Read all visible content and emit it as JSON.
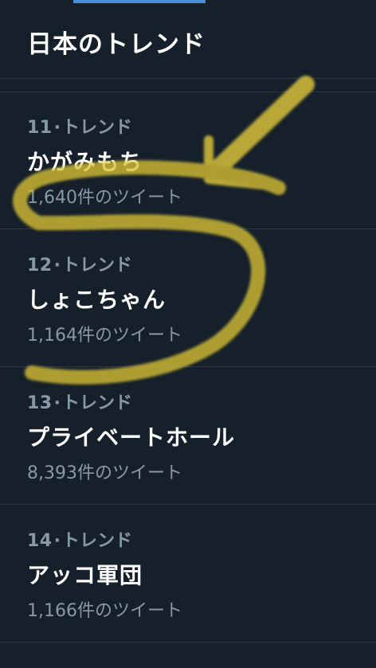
{
  "header": {
    "title": "日本のトレンド"
  },
  "trends": [
    {
      "rank": "11",
      "separator": "·",
      "label": "トレンド",
      "name": "かがみもち",
      "count": "1,640件のツイート"
    },
    {
      "rank": "12",
      "separator": "·",
      "label": "トレンド",
      "name": "しょこちゃん",
      "count": "1,164件のツイート"
    },
    {
      "rank": "13",
      "separator": "·",
      "label": "トレンド",
      "name": "プライベートホール",
      "count": "8,393件のツイート"
    },
    {
      "rank": "14",
      "separator": "·",
      "label": "トレンド",
      "name": "アッコ軍団",
      "count": "1,166件のツイート"
    }
  ],
  "colors": {
    "background": "#15202b",
    "divider": "#2b3744",
    "secondary_text": "#8899a6",
    "tab_indicator": "#4a8fd8",
    "annotation_marker": "#e8cf3a"
  },
  "annotation": {
    "icon": "hand-drawn-arrow-and-circle"
  }
}
